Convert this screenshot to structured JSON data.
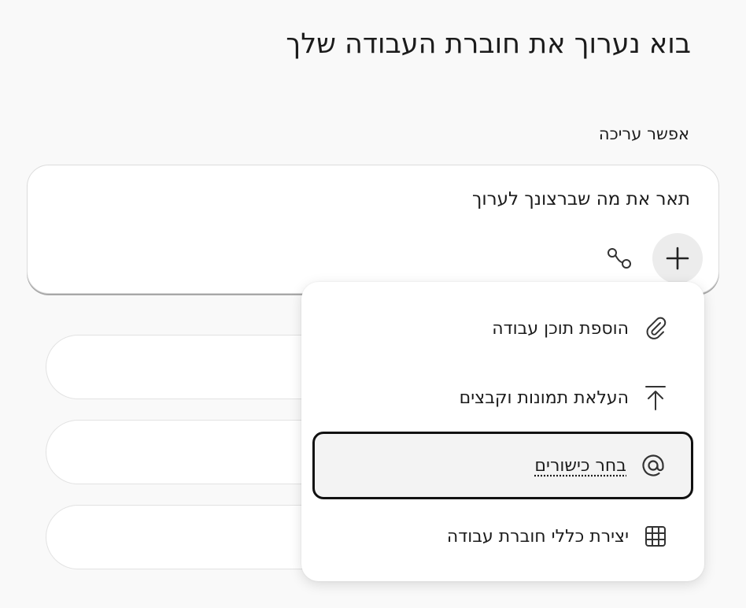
{
  "heading": "בוא נערוך את חוברת העבודה שלך",
  "subheading": "אפשר עריכה",
  "prompt": {
    "text": "תאר את מה שברצונך לערוך"
  },
  "icons": {
    "add": "plus-icon",
    "connectors": "link-icon"
  },
  "menu": {
    "items": [
      {
        "label": "הוספת תוכן עבודה",
        "icon": "paperclip-icon"
      },
      {
        "label": "העלאת תמונות וקבצים",
        "icon": "upload-icon"
      },
      {
        "label": "בחר כישורים",
        "icon": "at-sign-icon"
      },
      {
        "label": "יצירת כללי חוברת עבודה",
        "icon": "grid-icon"
      }
    ]
  }
}
